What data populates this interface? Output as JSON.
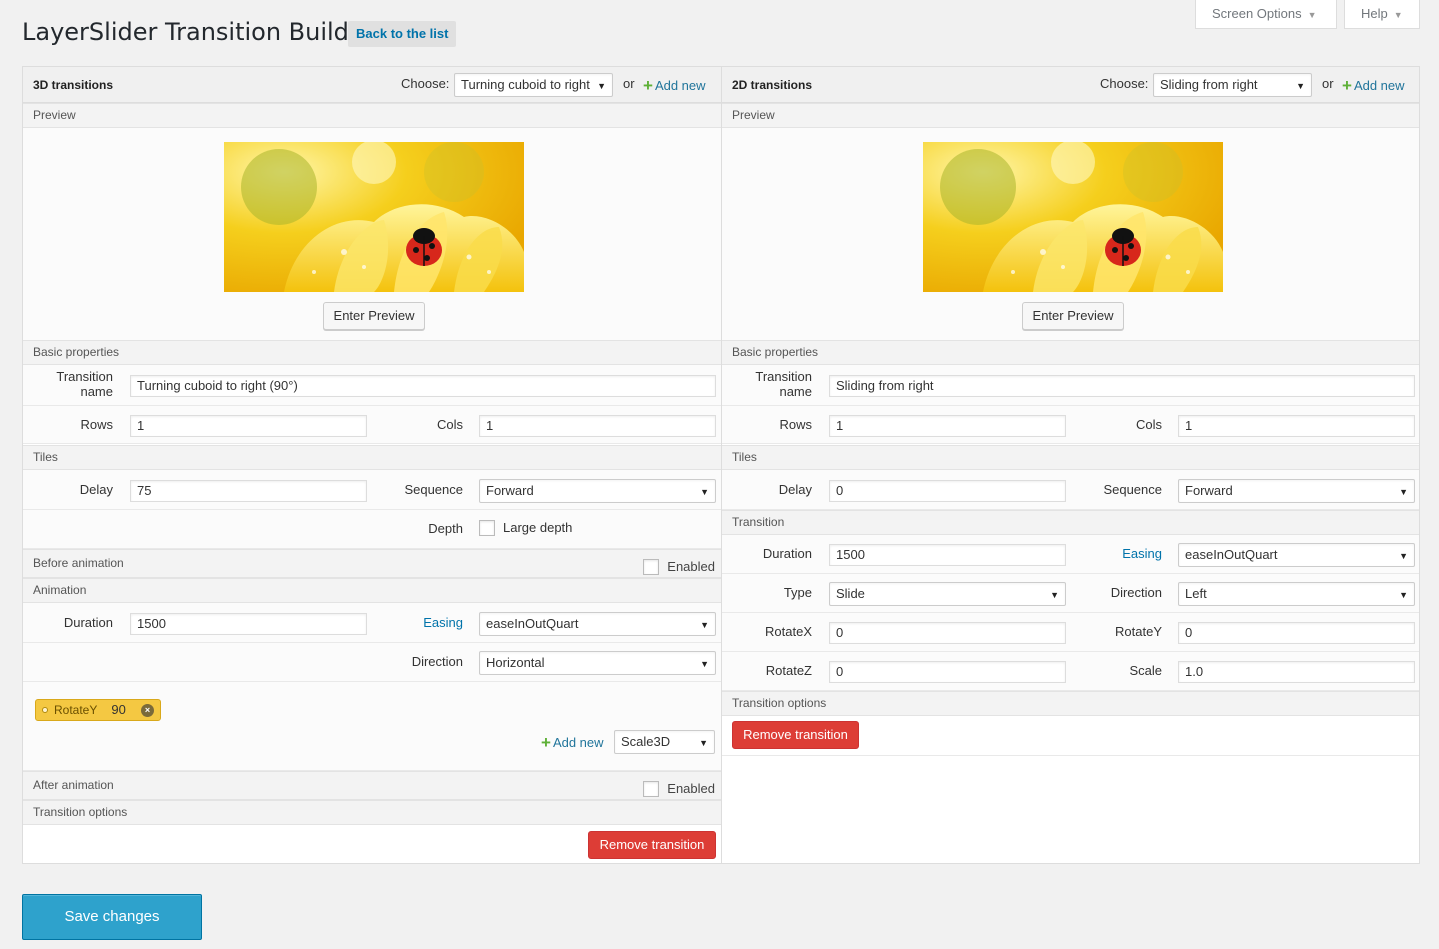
{
  "page": {
    "title": "LayerSlider Transition Builder",
    "back_label": "Back to the list",
    "screen_options": "Screen Options",
    "help": "Help",
    "save_label": "Save changes"
  },
  "common": {
    "choose": "Choose:",
    "or": "or",
    "add_new": "Add new",
    "preview": "Preview",
    "enter_preview": "Enter Preview",
    "basic_properties": "Basic properties",
    "transition_name": "Transition name",
    "rows": "Rows",
    "cols": "Cols",
    "tiles": "Tiles",
    "delay": "Delay",
    "sequence": "Sequence",
    "duration": "Duration",
    "easing": "Easing",
    "direction": "Direction",
    "transition_options": "Transition options",
    "remove_transition": "Remove transition",
    "enabled": "Enabled"
  },
  "left": {
    "title": "3D transitions",
    "selected": "Turning cuboid to right",
    "name_value": "Turning cuboid to right (90°)",
    "rows_value": "1",
    "cols_value": "1",
    "delay_value": "75",
    "sequence_value": "Forward",
    "depth_label": "Depth",
    "large_depth": "Large depth",
    "before_animation": "Before animation",
    "animation": "Animation",
    "duration_value": "1500",
    "easing_value": "easeInOutQuart",
    "direction_value": "Horizontal",
    "tag_label": "RotateY",
    "tag_value": "90",
    "tag_select": "Scale3D",
    "after_animation": "After animation"
  },
  "right": {
    "title": "2D transitions",
    "selected": "Sliding from right",
    "name_value": "Sliding from right",
    "rows_value": "1",
    "cols_value": "1",
    "delay_value": "0",
    "sequence_value": "Forward",
    "transition": "Transition",
    "duration_value": "1500",
    "easing_value": "easeInOutQuart",
    "type_label": "Type",
    "type_value": "Slide",
    "direction_value": "Left",
    "rotatex_label": "RotateX",
    "rotatex_value": "0",
    "rotatey_label": "RotateY",
    "rotatey_value": "0",
    "rotatez_label": "RotateZ",
    "rotatez_value": "0",
    "scale_label": "Scale",
    "scale_value": "1.0"
  },
  "colors": {
    "primary_button": "#2ea2cc",
    "danger_button": "#dd3d36",
    "link": "#0073aa",
    "tag": "#f4c842"
  }
}
